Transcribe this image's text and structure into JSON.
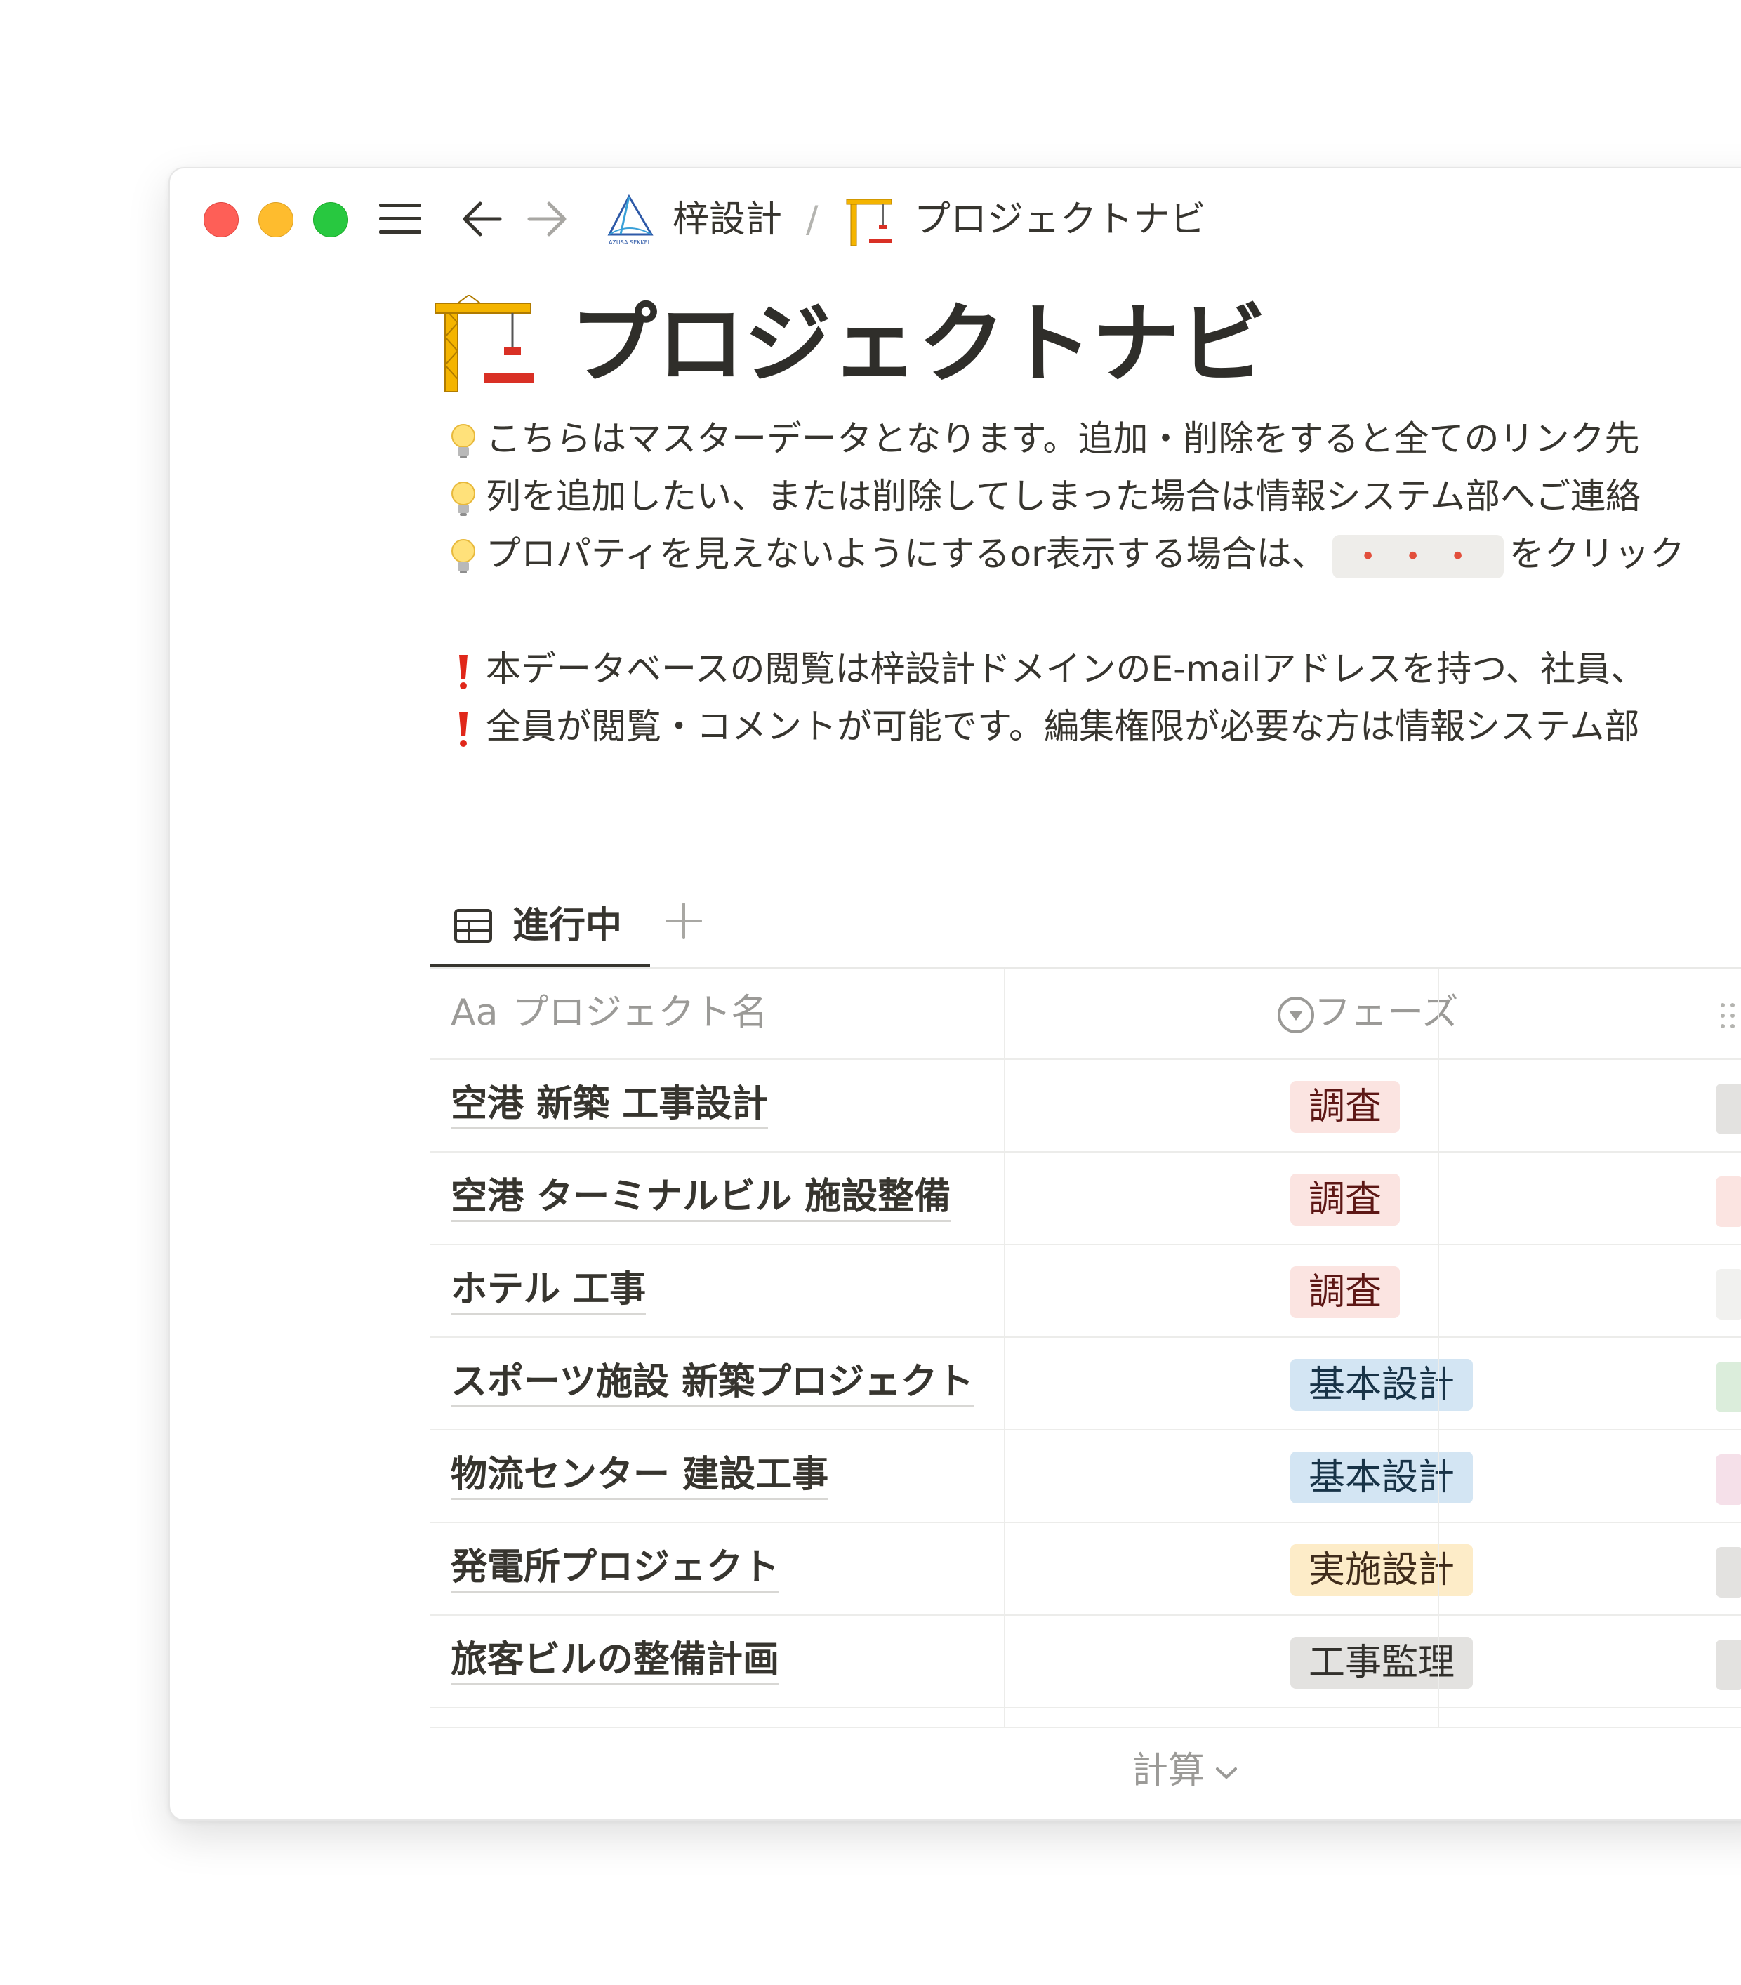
{
  "breadcrumb": {
    "workspace": "梓設計",
    "separator": "/",
    "page": "プロジェクトナビ",
    "logo_text": "AZUSA SEKKEI"
  },
  "page": {
    "title": "プロジェクトナビ",
    "icon": "construction-crane-icon"
  },
  "callouts": [
    {
      "icon": "lightbulb-icon",
      "text": "こちらはマスターデータとなります。追加・削除をすると全てのリンク先"
    },
    {
      "icon": "lightbulb-icon",
      "text": "列を追加したい、または削除してしまった場合は情報システム部へご連絡"
    },
    {
      "icon": "lightbulb-icon",
      "text_before": "プロパティを見えないようにするor表示する場合は、",
      "code": "・・・",
      "text_after": "をクリック"
    },
    {
      "icon": "exclamation-icon",
      "text": "本データベースの閲覧は梓設計ドメインのE-mailアドレスを持つ、社員、"
    },
    {
      "icon": "exclamation-icon",
      "text": "全員が閲覧・コメントが可能です。編集権限が必要な方は情報システム部"
    }
  ],
  "views": {
    "active": "進行中",
    "add_label": "+"
  },
  "table": {
    "columns": [
      {
        "prefix": "Aa",
        "label": "プロジェクト名"
      },
      {
        "label": "フェーズ"
      }
    ],
    "rows": [
      {
        "name": "空港 新築 工事設計",
        "phase": "調査",
        "phase_color": "#fbe4e1"
      },
      {
        "name": "空港 ターミナルビル 施設整備",
        "phase": "調査",
        "phase_color": "#fbe4e1"
      },
      {
        "name": "ホテル 工事",
        "phase": "調査",
        "phase_color": "#fbe4e1"
      },
      {
        "name": "スポーツ施設 新築プロジェクト",
        "phase": "基本設計",
        "phase_color": "#d3e5f3"
      },
      {
        "name": "物流センター 建設工事",
        "phase": "基本設計",
        "phase_color": "#d3e5f3"
      },
      {
        "name": "発電所プロジェクト",
        "phase": "実施設計",
        "phase_color": "#fdecc8"
      },
      {
        "name": "旅客ビルの整備計画",
        "phase": "工事監理",
        "phase_color": "#e3e2e0"
      }
    ],
    "calc_label": "計算"
  }
}
